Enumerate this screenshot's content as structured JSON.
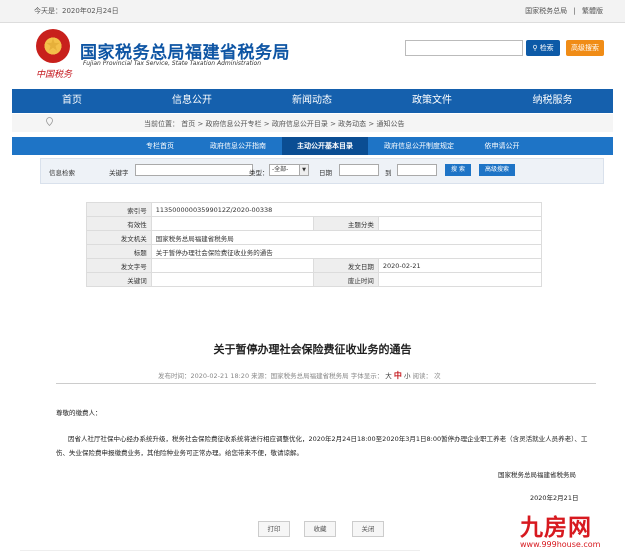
{
  "topbar": {
    "date": "今天是：2020年02月24日",
    "link_main": "国家税务总局",
    "sep": "|",
    "link_trad": "繁體版"
  },
  "header": {
    "signature": "中国税务",
    "title": "国家税务总局福建省税务局",
    "subtitle": "Fujian Provincial Tax Service, State Taxation Administration",
    "search_button": "检索",
    "advanced_button": "高级搜索"
  },
  "nav": {
    "items": [
      "首页",
      "信息公开",
      "新闻动态",
      "政策文件",
      "纳税服务"
    ]
  },
  "breadcrumb": "当前位置： 首页 > 政府信息公开专栏 > 政府信息公开目录 > 政务动态 > 通知公告",
  "tabs": [
    "专栏首页",
    "政府信息公开指南",
    "主动公开基本目录",
    "政府信息公开制度规定",
    "依申请公开"
  ],
  "filter": {
    "title": "信息检索",
    "keyword_label": "关键字",
    "type_label": "类型：",
    "type_value": "-全部-",
    "date_label": "日期",
    "to_label": "到",
    "search_btn": "搜 索",
    "advanced_btn": "高级搜索"
  },
  "meta": {
    "index_label": "索引号",
    "index_value": "11350000003599012Z/2020-00338",
    "validity_label": "有效性",
    "validity_value": "",
    "category_label": "主题分类",
    "category_value": "",
    "issuer_label": "发文机关",
    "issuer_value": "国家税务总局福建省税务局",
    "subject_label": "标题",
    "subject_value": "关于暂停办理社会保险费征收业务的通告",
    "docno_label": "发文字号",
    "docno_value": "",
    "pubdate_label": "发文日期",
    "pubdate_value": "2020-02-21",
    "keywords_label": "关键词",
    "keywords_value": "",
    "expiry_label": "废止时间",
    "expiry_value": ""
  },
  "doc": {
    "title": "关于暂停办理社会保险费征收业务的通告",
    "info_prefix": "发布时间：2020-02-21 18:20    来源：国家税务总局福建省税务局    字体显示：",
    "font_large": "大",
    "font_medium": "中",
    "font_small": "小",
    "info_suffix": "    阅读：",
    "reads": "次",
    "salutation": "尊敬的缴费人：",
    "body": "因省人社厅社保中心经办系统升级，税务社会保险费征收系统将进行相应调整优化，2020年2月24日18:00至2020年3月1日8:00暂停办理企业职工养老（含灵活就业人员养老）、工伤、失业保险费申报缴费业务，其他险种业务可正常办理。给您带来不便，敬请谅解。",
    "org": "国家税务总局福建省税务局",
    "date": "2020年2月21日"
  },
  "actions": [
    "打印",
    "收藏",
    "关闭"
  ],
  "watermark": {
    "brand": "九房网",
    "url": "www.999house.com"
  }
}
